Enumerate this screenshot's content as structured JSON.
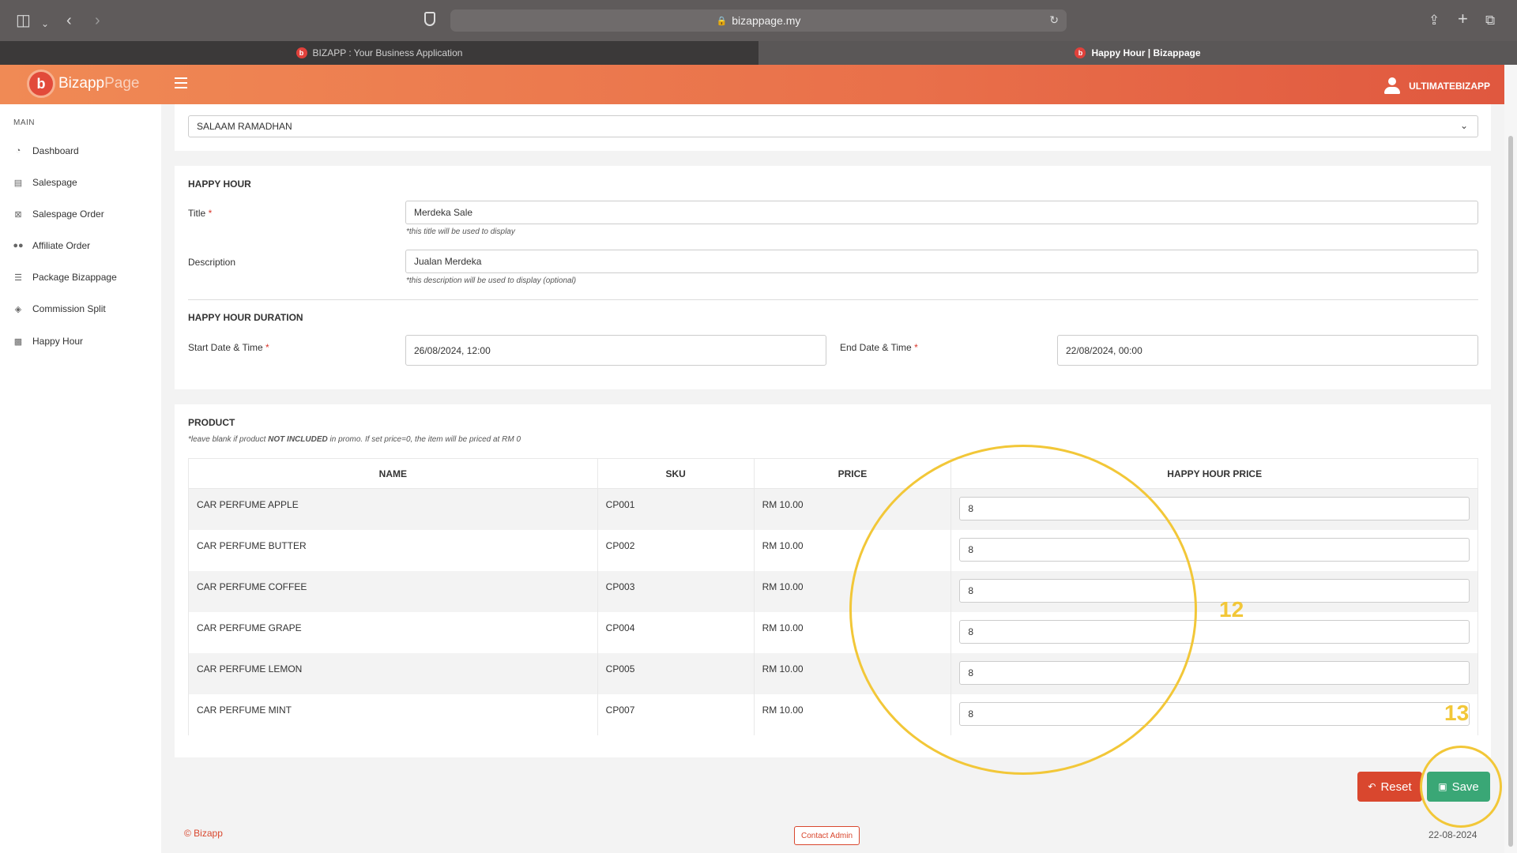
{
  "browser": {
    "url": "bizappage.my",
    "tabs": [
      {
        "label": "BIZAPP : Your Business Application",
        "active": false
      },
      {
        "label": "Happy Hour | Bizappage",
        "active": true
      }
    ]
  },
  "header": {
    "logo_part1": "Bizapp",
    "logo_part2": "Page",
    "username": "ULTIMATEBIZAPP"
  },
  "sidebar": {
    "section": "MAIN",
    "items": [
      {
        "label": "Dashboard",
        "icon": "dashboard-icon"
      },
      {
        "label": "Salespage",
        "icon": "calendar-icon"
      },
      {
        "label": "Salespage Order",
        "icon": "cart-icon"
      },
      {
        "label": "Affiliate Order",
        "icon": "users-icon"
      },
      {
        "label": "Package Bizappage",
        "icon": "list-icon"
      },
      {
        "label": "Commission Split",
        "icon": "diamond-icon"
      },
      {
        "label": "Happy Hour",
        "icon": "card-icon"
      }
    ]
  },
  "salespage_select": {
    "value": "SALAAM RAMADHAN"
  },
  "happy_hour": {
    "section_title": "HAPPY HOUR",
    "title_label": "Title",
    "title_value": "Merdeka Sale",
    "title_help": "*this title will be used to display",
    "description_label": "Description",
    "description_value": "Jualan Merdeka",
    "description_help": "*this description will be used to display (optional)",
    "required_mark": "*"
  },
  "duration": {
    "section_title": "HAPPY HOUR DURATION",
    "start_label": "Start Date & Time",
    "start_value": "26/08/2024, 12:00",
    "end_label": "End Date & Time",
    "end_value": "22/08/2024, 00:00"
  },
  "product": {
    "section_title": "PRODUCT",
    "note_prefix": "*leave blank if product ",
    "note_bold": "NOT INCLUDED",
    "note_suffix": " in promo. If set price=0, the item will be priced at RM 0",
    "columns": [
      "NAME",
      "SKU",
      "PRICE",
      "HAPPY HOUR PRICE"
    ],
    "rows": [
      {
        "name": "CAR PERFUME APPLE",
        "sku": "CP001",
        "price": "RM 10.00",
        "hh_price": "8"
      },
      {
        "name": "CAR PERFUME BUTTER",
        "sku": "CP002",
        "price": "RM 10.00",
        "hh_price": "8"
      },
      {
        "name": "CAR PERFUME COFFEE",
        "sku": "CP003",
        "price": "RM 10.00",
        "hh_price": "8"
      },
      {
        "name": "CAR PERFUME GRAPE",
        "sku": "CP004",
        "price": "RM 10.00",
        "hh_price": "8"
      },
      {
        "name": "CAR PERFUME LEMON",
        "sku": "CP005",
        "price": "RM 10.00",
        "hh_price": "8"
      },
      {
        "name": "CAR PERFUME MINT",
        "sku": "CP007",
        "price": "RM 10.00",
        "hh_price": "8"
      }
    ]
  },
  "actions": {
    "reset_label": "Reset",
    "save_label": "Save"
  },
  "annotations": {
    "label_a": "12",
    "label_b": "13",
    "color": "#f2c738"
  },
  "footer": {
    "copyright": "© Bizapp",
    "contact_label": "Contact Admin",
    "date": "22-08-2024"
  },
  "colors": {
    "accent": "#e9704a",
    "danger": "#d9472e",
    "success": "#3aa776"
  }
}
